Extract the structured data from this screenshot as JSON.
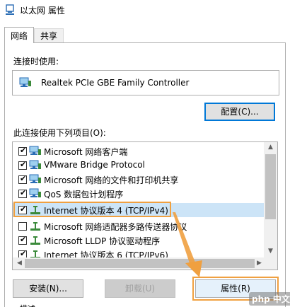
{
  "window": {
    "title": "以太网 属性"
  },
  "tabs": [
    {
      "label": "网络"
    },
    {
      "label": "共享"
    }
  ],
  "connect_using": {
    "label": "连接时使用:",
    "adapter": "Realtek PCIe GBE Family Controller"
  },
  "buttons": {
    "configure": "配置(C)...",
    "install": "安装(N)...",
    "uninstall": "卸载(U)",
    "properties": "属性(R)"
  },
  "items_section": {
    "label": "此连接使用下列项目(O):"
  },
  "items": [
    {
      "label": "Microsoft 网络客户端",
      "checked": true,
      "icon": "network-client-icon"
    },
    {
      "label": "VMware Bridge Protocol",
      "checked": true,
      "icon": "network-client-icon"
    },
    {
      "label": "Microsoft 网络的文件和打印机共享",
      "checked": true,
      "icon": "network-client-icon"
    },
    {
      "label": "QoS 数据包计划程序",
      "checked": true,
      "icon": "network-client-icon"
    },
    {
      "label": "Internet 协议版本 4 (TCP/IPv4)",
      "checked": true,
      "icon": "protocol-icon"
    },
    {
      "label": "Microsoft 网络适配器多路传送器协议",
      "checked": false,
      "icon": "protocol-icon"
    },
    {
      "label": "Microsoft LLDP 协议驱动程序",
      "checked": true,
      "icon": "protocol-icon"
    },
    {
      "label": "Internet 协议版本 6 (TCP/IPv6)",
      "checked": true,
      "icon": "protocol-icon"
    }
  ],
  "description_peek": "描述",
  "watermark": "php 中文网",
  "colors": {
    "highlight_outline": "#f0a040",
    "selection": "#cce4f7",
    "focus_border": "#0078d7"
  }
}
